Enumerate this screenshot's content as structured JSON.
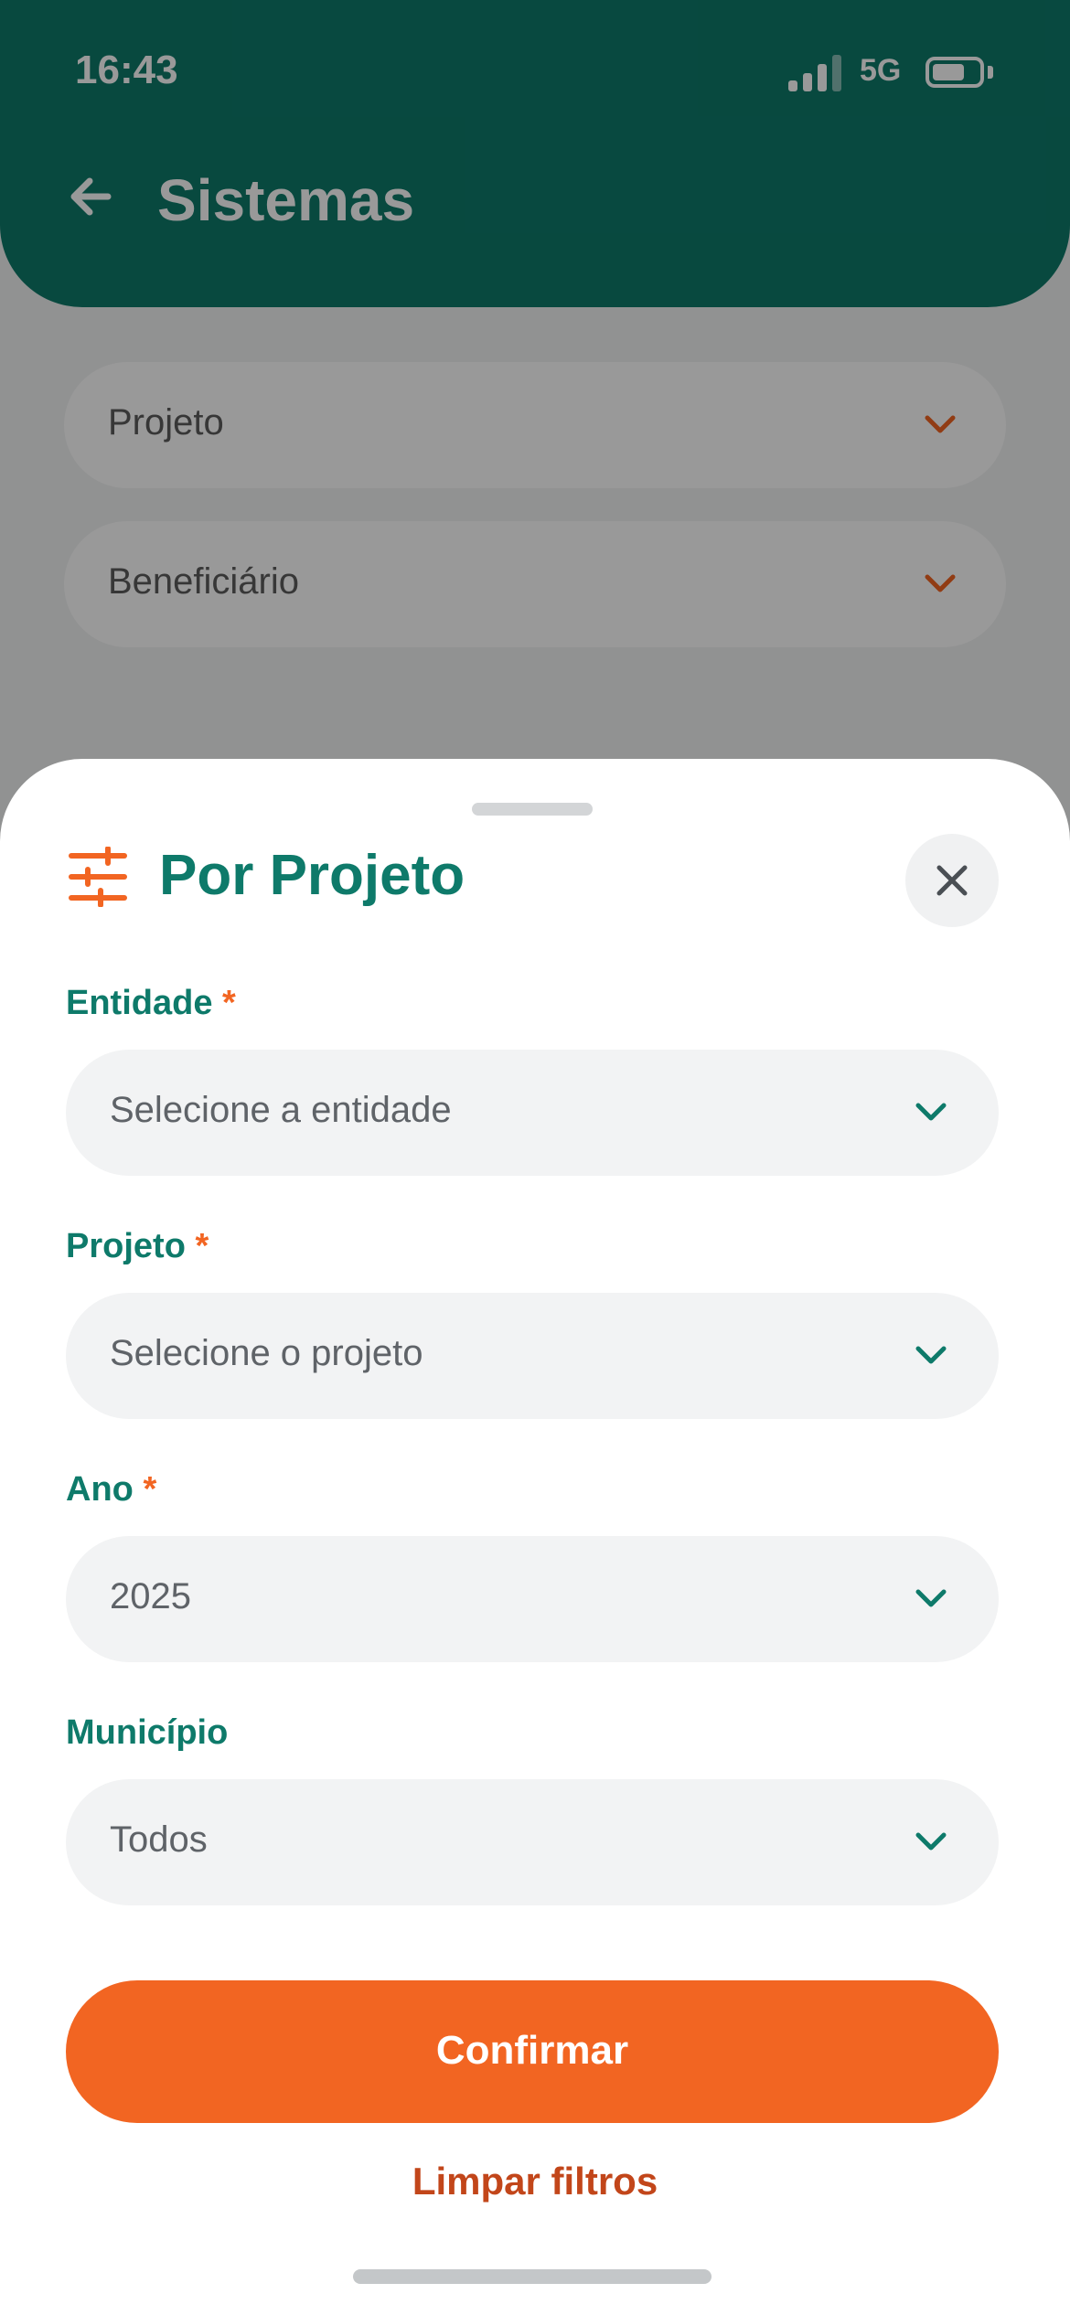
{
  "status_bar": {
    "time": "16:43",
    "network": "5G"
  },
  "header": {
    "title": "Sistemas"
  },
  "background_filters": [
    {
      "label": "Projeto"
    },
    {
      "label": "Beneficiário"
    }
  ],
  "sheet": {
    "title": "Por Projeto",
    "fields": [
      {
        "label": "Entidade",
        "required_mark": "*",
        "value": "Selecione a entidade"
      },
      {
        "label": "Projeto",
        "required_mark": "*",
        "value": "Selecione o projeto"
      },
      {
        "label": "Ano",
        "required_mark": "*",
        "value": "2025"
      },
      {
        "label": "Município",
        "required_mark": "",
        "value": "Todos"
      }
    ],
    "confirm_label": "Confirmar",
    "clear_label": "Limpar filtros"
  },
  "colors": {
    "brand_green": "#0e7a6a",
    "accent_orange": "#f26522",
    "link_orange": "#c2461a",
    "field_bg": "#f2f3f4"
  },
  "icons": {
    "back": "arrow-left-icon",
    "filter": "sliders-icon",
    "close": "close-icon",
    "dropdown": "chevron-down-icon"
  }
}
